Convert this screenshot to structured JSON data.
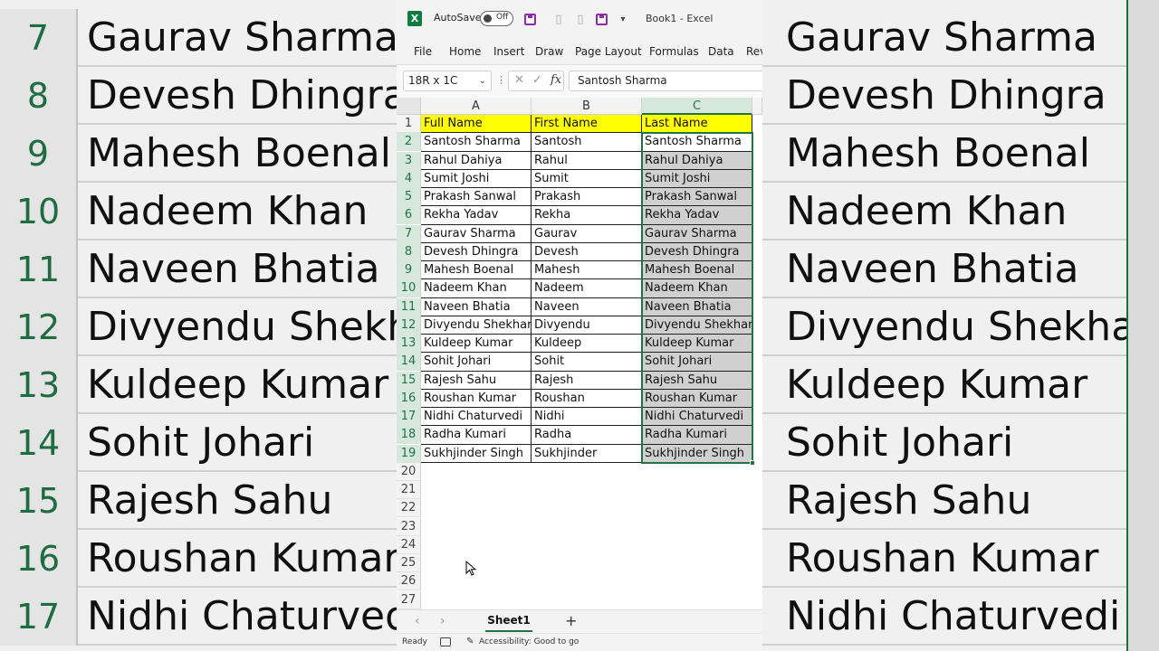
{
  "titlebar": {
    "autosave_label": "AutoSave",
    "autosave_state": "Off",
    "doc_title": "Book1  -  Excel",
    "logo_letter": "X"
  },
  "ribbon": {
    "tabs": [
      "File",
      "Home",
      "Insert",
      "Draw",
      "Page Layout",
      "Formulas",
      "Data",
      "Rev"
    ]
  },
  "formula_bar": {
    "name_box": "18R x 1C",
    "formula_value": "Santosh Sharma",
    "fx_label": "fx"
  },
  "grid": {
    "columns": [
      "A",
      "B",
      "C"
    ],
    "selected_column": "C",
    "row_numbers": [
      1,
      2,
      3,
      4,
      5,
      6,
      7,
      8,
      9,
      10,
      11,
      12,
      13,
      14,
      15,
      16,
      17,
      18,
      19,
      20,
      21,
      22,
      23,
      24,
      25,
      26,
      27
    ],
    "header_row": [
      "Full Name",
      "First Name",
      "Last Name"
    ],
    "rows": [
      [
        "Santosh Sharma",
        "Santosh",
        "Santosh Sharma"
      ],
      [
        "Rahul Dahiya",
        "Rahul",
        "Rahul Dahiya"
      ],
      [
        "Sumit Joshi",
        "Sumit",
        "Sumit Joshi"
      ],
      [
        "Prakash Sanwal",
        "Prakash",
        "Prakash Sanwal"
      ],
      [
        "Rekha Yadav",
        "Rekha",
        "Rekha Yadav"
      ],
      [
        "Gaurav Sharma",
        "Gaurav",
        "Gaurav Sharma"
      ],
      [
        "Devesh Dhingra",
        "Devesh",
        "Devesh Dhingra"
      ],
      [
        "Mahesh Boenal",
        "Mahesh",
        "Mahesh Boenal"
      ],
      [
        "Nadeem Khan",
        "Nadeem",
        "Nadeem Khan"
      ],
      [
        "Naveen Bhatia",
        "Naveen",
        "Naveen Bhatia"
      ],
      [
        "Divyendu Shekhar",
        "Divyendu",
        "Divyendu Shekhar"
      ],
      [
        "Kuldeep Kumar",
        "Kuldeep",
        "Kuldeep Kumar"
      ],
      [
        "Sohit Johari",
        "Sohit",
        "Sohit Johari"
      ],
      [
        "Rajesh Sahu",
        "Rajesh",
        "Rajesh Sahu"
      ],
      [
        "Roushan Kumar",
        "Roushan",
        "Roushan Kumar"
      ],
      [
        "Nidhi Chaturvedi",
        "Nidhi",
        "Nidhi Chaturvedi"
      ],
      [
        "Radha Kumari",
        "Radha",
        "Radha Kumari"
      ],
      [
        "Sukhjinder Singh",
        "Sukhjinder",
        "Sukhjinder Singh"
      ]
    ]
  },
  "sheets": {
    "tabs": [
      "Sheet1"
    ],
    "add_label": "+"
  },
  "status": {
    "ready": "Ready",
    "accessibility": "Accessibility: Good to go"
  },
  "background_zoom": {
    "left": [
      {
        "num": "7",
        "name": "Gaurav Sharma"
      },
      {
        "num": "8",
        "name": "Devesh Dhingra"
      },
      {
        "num": "9",
        "name": "Mahesh Boenal"
      },
      {
        "num": "10",
        "name": "Nadeem Khan"
      },
      {
        "num": "11",
        "name": "Naveen Bhatia"
      },
      {
        "num": "12",
        "name": "Divyendu Shekha"
      },
      {
        "num": "13",
        "name": "Kuldeep Kumar"
      },
      {
        "num": "14",
        "name": "Sohit Johari"
      },
      {
        "num": "15",
        "name": "Rajesh Sahu"
      },
      {
        "num": "16",
        "name": "Roushan Kumar"
      },
      {
        "num": "17",
        "name": "Nidhi Chaturvedi"
      }
    ],
    "right": [
      "Gaurav Sharma",
      "Devesh Dhingra",
      "Mahesh Boenal",
      "Nadeem Khan",
      "Naveen Bhatia",
      "Divyendu Shekhar",
      "Kuldeep Kumar",
      "Sohit Johari",
      "Rajesh Sahu",
      "Roushan Kumar",
      "Nidhi Chaturvedi"
    ]
  },
  "colors": {
    "accent": "#217346",
    "header_fill": "#ffff00",
    "selection_fill": "#d0d0d0"
  }
}
